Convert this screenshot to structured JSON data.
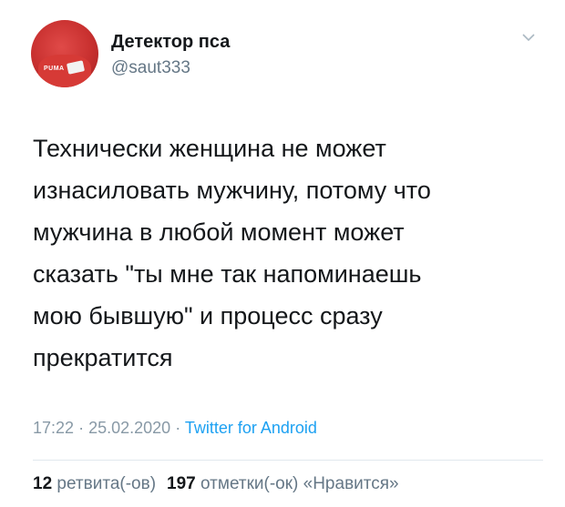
{
  "user": {
    "display_name": "Детектор пса",
    "handle": "@saut333",
    "avatar_logo": "PUMA"
  },
  "tweet": {
    "text": "Технически женщина не может\nизнасиловать мужчину, потому что\nмужчина в любой момент может\nсказать \"ты мне так напоминаешь\nмою бывшую\" и процесс сразу\nпрекратится",
    "time": "17:22",
    "separator": "·",
    "date": "25.02.2020",
    "source": "Twitter for Android"
  },
  "stats": {
    "retweets_count": "12",
    "retweets_label": "ретвита(-ов)",
    "likes_count": "197",
    "likes_label": "отметки(-ок) «Нравится»"
  },
  "colors": {
    "text": "#14171a",
    "secondary": "#657786",
    "link": "#1da1f2",
    "divider": "#e1e8ed"
  },
  "icons": {
    "menu": "chevron-down-icon"
  }
}
